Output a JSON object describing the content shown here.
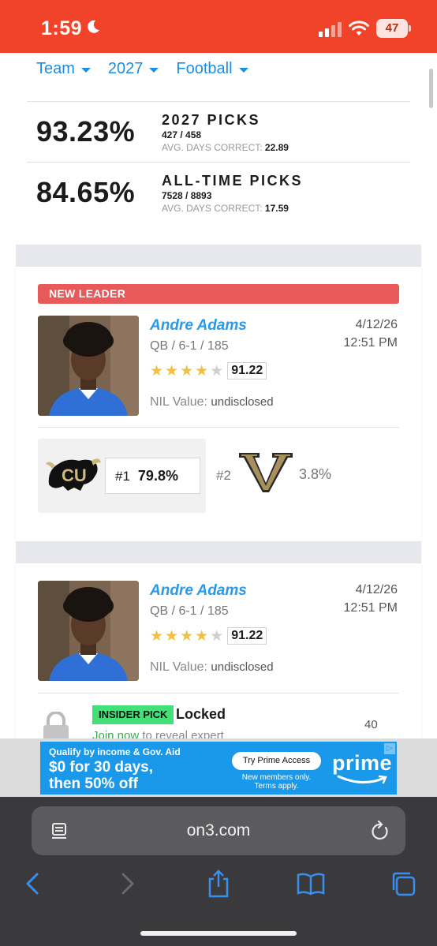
{
  "status_bar": {
    "time": "1:59",
    "battery": "47"
  },
  "filters": [
    {
      "label": "Team"
    },
    {
      "label": "2027"
    },
    {
      "label": "Football"
    }
  ],
  "stats": [
    {
      "pct": "93.23%",
      "label": "2027 PICKS",
      "counts": "427 / 458",
      "avg_label": "AVG. DAYS CORRECT:",
      "avg_value": "22.89"
    },
    {
      "pct": "84.65%",
      "label": "ALL-TIME PICKS",
      "counts": "7528 / 8893",
      "avg_label": "AVG. DAYS CORRECT:",
      "avg_value": "17.59"
    }
  ],
  "cards": [
    {
      "banner": "NEW LEADER",
      "name": "Andre Adams",
      "meta": "QB / 6-1 / 185",
      "stars_filled": 4,
      "stars_total": 5,
      "rating": "91.22",
      "nil_label": "NIL Value:",
      "nil_value": "undisclosed",
      "date": "4/12/26",
      "time": "12:51 PM",
      "pick1_rank": "#1",
      "pick1_pct": "79.8%",
      "pick2_rank": "#2",
      "pick2_pct": "3.8%"
    },
    {
      "name": "Andre Adams",
      "meta": "QB / 6-1 / 185",
      "stars_filled": 4,
      "stars_total": 5,
      "rating": "91.22",
      "nil_label": "NIL Value:",
      "nil_value": "undisclosed",
      "date": "4/12/26",
      "time": "12:51 PM",
      "insider_badge": "INSIDER PICK",
      "locked_label": "Locked",
      "join_link": "Join now",
      "join_rest": "to reveal expert",
      "count": "40"
    }
  ],
  "ad": {
    "line1": "Qualify by income & Gov. Aid",
    "line2": "$0 for 30 days,",
    "line3": "then 50% off",
    "button": "Try Prime Access",
    "terms1": "New members only.",
    "terms2": "Terms apply.",
    "brand": "prime",
    "colors": {
      "background": "#1a98ea"
    }
  },
  "browser": {
    "url": "on3.com"
  },
  "colors": {
    "status_bar": "#f0432a",
    "link_blue": "#1a8ee0",
    "banner_red": "#e85a5a",
    "insider_green": "#43e07a",
    "star_gold": "#f0c040"
  }
}
